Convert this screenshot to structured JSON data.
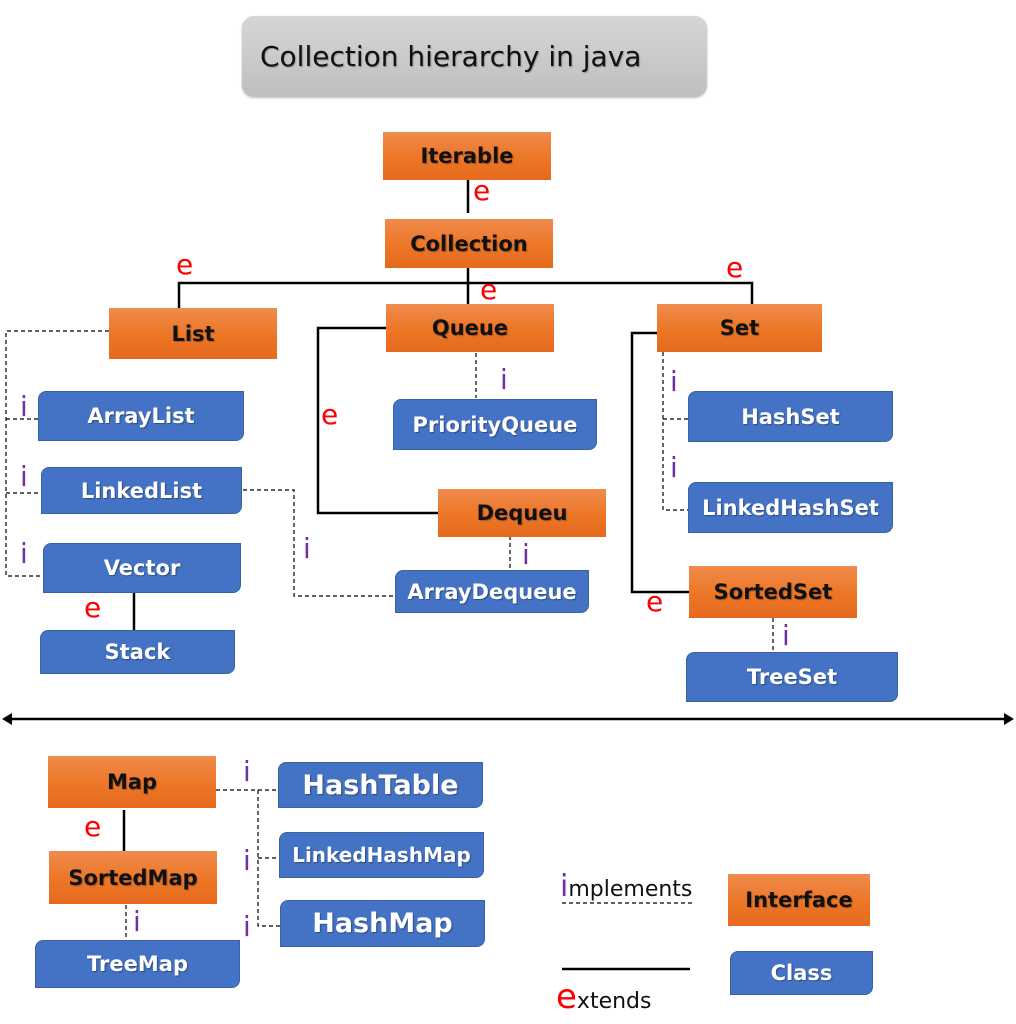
{
  "title": "Collection hierarchy in java",
  "nodes": {
    "iterable": "Iterable",
    "collection": "Collection",
    "list": "List",
    "queue": "Queue",
    "set": "Set",
    "arraylist": "ArrayList",
    "linkedlist": "LinkedList",
    "vector": "Vector",
    "stack": "Stack",
    "priorityqueue": "PriorityQueue",
    "dequeu": "Dequeu",
    "arraydequeue": "ArrayDequeue",
    "hashset": "HashSet",
    "linkedhashset": "LinkedHashSet",
    "sortedset": "SortedSet",
    "treeset": "TreeSet",
    "map": "Map",
    "sortedmap": "SortedMap",
    "treemap": "TreeMap",
    "hashtable": "HashTable",
    "linkedhashmap": "LinkedHashMap",
    "hashmap": "HashMap"
  },
  "relation_markers": {
    "extends": "e",
    "implements": "i"
  },
  "edges": [
    {
      "from": "Collection",
      "to": "Iterable",
      "type": "extends"
    },
    {
      "from": "List",
      "to": "Collection",
      "type": "extends"
    },
    {
      "from": "Queue",
      "to": "Collection",
      "type": "extends"
    },
    {
      "from": "Set",
      "to": "Collection",
      "type": "extends"
    },
    {
      "from": "ArrayList",
      "to": "List",
      "type": "implements"
    },
    {
      "from": "LinkedList",
      "to": "List",
      "type": "implements"
    },
    {
      "from": "Vector",
      "to": "List",
      "type": "implements"
    },
    {
      "from": "Stack",
      "to": "Vector",
      "type": "extends"
    },
    {
      "from": "PriorityQueue",
      "to": "Queue",
      "type": "implements"
    },
    {
      "from": "Dequeu",
      "to": "Queue",
      "type": "extends"
    },
    {
      "from": "ArrayDequeue",
      "to": "Dequeu",
      "type": "implements"
    },
    {
      "from": "LinkedList",
      "to": "Dequeu",
      "type": "implements"
    },
    {
      "from": "HashSet",
      "to": "Set",
      "type": "implements"
    },
    {
      "from": "LinkedHashSet",
      "to": "Set",
      "type": "implements"
    },
    {
      "from": "SortedSet",
      "to": "Set",
      "type": "extends"
    },
    {
      "from": "TreeSet",
      "to": "SortedSet",
      "type": "implements"
    },
    {
      "from": "SortedMap",
      "to": "Map",
      "type": "extends"
    },
    {
      "from": "TreeMap",
      "to": "SortedMap",
      "type": "implements"
    },
    {
      "from": "HashTable",
      "to": "Map",
      "type": "implements"
    },
    {
      "from": "LinkedHashMap",
      "to": "Map",
      "type": "implements"
    },
    {
      "from": "HashMap",
      "to": "Map",
      "type": "implements"
    }
  ],
  "legend": {
    "implements_first": "i",
    "implements_rest": "mplements",
    "extends_first": "e",
    "extends_rest": "xtends",
    "interface": "Interface",
    "class": "Class"
  },
  "colors": {
    "interface": "#ec7626",
    "class": "#4472c4",
    "extends_marker": "#ff0000",
    "implements_marker": "#7030a0"
  }
}
